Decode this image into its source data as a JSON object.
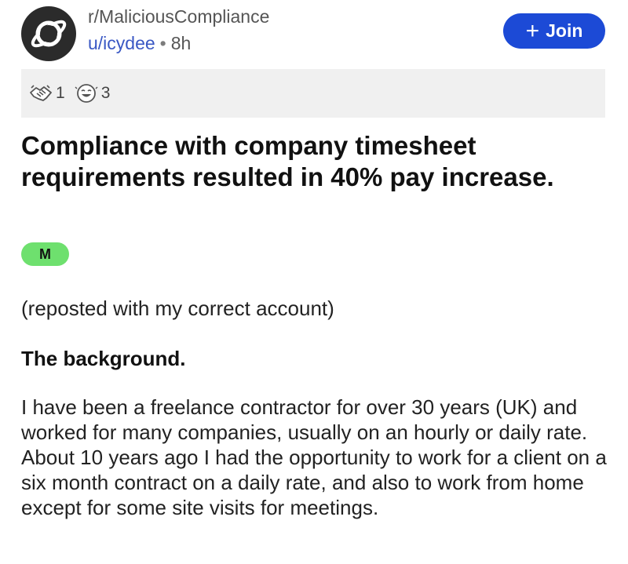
{
  "post": {
    "subreddit": "r/MaliciousCompliance",
    "username": "u/icydee",
    "separator": "•",
    "age": "8h",
    "join_label": "Join",
    "awards": [
      {
        "icon": "handshake-award-icon",
        "count": "1"
      },
      {
        "icon": "laughing-face-award-icon",
        "count": "3"
      }
    ],
    "title": "Compliance with company timesheet requirements resulted in 40% pay increase.",
    "flair": "M",
    "repost_note": "(reposted with my correct account)",
    "section_heading": "The background.",
    "body": "I have been a freelance contractor for over 30 years (UK) and worked for many companies, usually on an hourly or daily rate. About 10 years ago I had the opportunity to work for a client on a six month contract on a daily rate, and also to work from home except for some site visits for meetings."
  },
  "colors": {
    "join_button": "#1c4ad6",
    "username": "#3a58c4",
    "flair": "#6ee06e",
    "awards_bar": "#f0f0f0"
  }
}
